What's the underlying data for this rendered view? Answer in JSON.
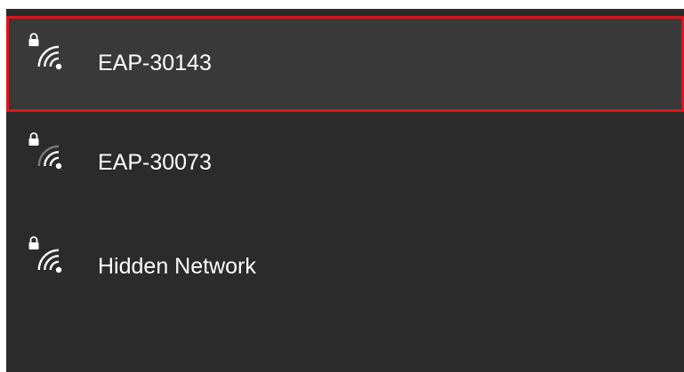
{
  "networks": [
    {
      "name": "EAP-30143",
      "secured": true,
      "icon": "wifi-secured-full-icon",
      "highlight_color": "#e0141c"
    },
    {
      "name": "EAP-30073",
      "secured": true,
      "icon": "wifi-secured-weak-icon"
    },
    {
      "name": "Hidden Network",
      "secured": true,
      "icon": "wifi-secured-full-icon"
    }
  ],
  "colors": {
    "background": "#2b2b2b",
    "highlight_background": "#393939",
    "text": "#ffffff",
    "signal_dim": "#7a7a7a"
  }
}
